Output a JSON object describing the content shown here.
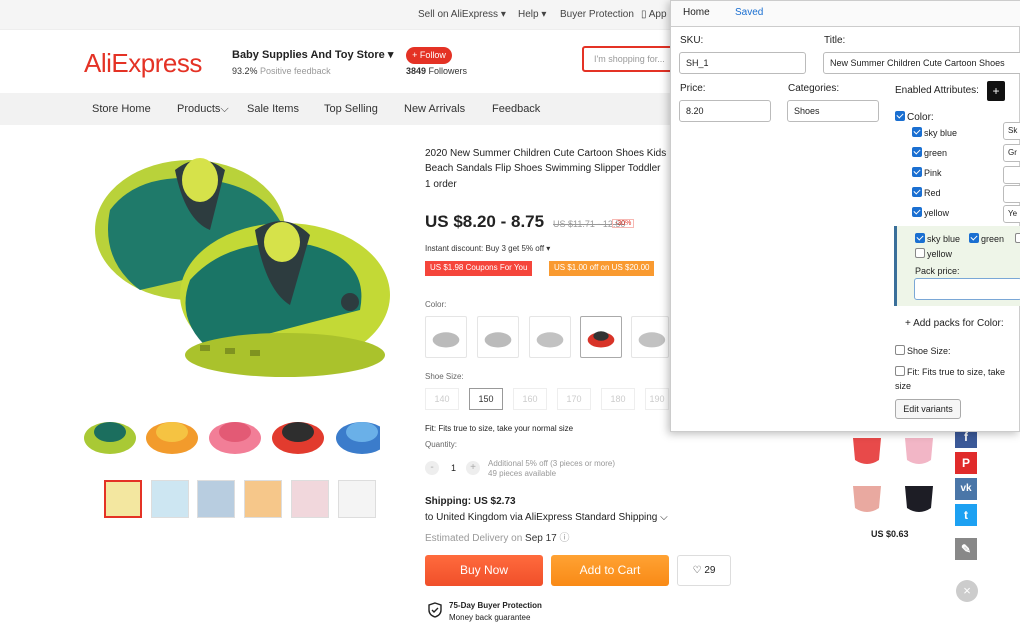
{
  "topbar": {
    "sell": "Sell on AliExpress",
    "help": "Help",
    "protection": "Buyer Protection",
    "app": "App"
  },
  "header": {
    "logo": "AliExpress",
    "store": "Baby Supplies And Toy Store",
    "feedback_pct": "93.2%",
    "feedback_lbl": "Positive feedback",
    "follow": "+ Follow",
    "followers_count": "3849",
    "followers_lbl": "Followers",
    "search_placeholder": "I'm shopping for..."
  },
  "nav": [
    "Store Home",
    "Products",
    "Sale Items",
    "Top Selling",
    "New Arrivals",
    "Feedback"
  ],
  "product": {
    "title": "2020 New Summer Children Cute Cartoon Shoes Kids Beach Sandals Flip Shoes Swimming Slipper Toddler",
    "orders": "1 order",
    "price": "US $8.20 - 8.75",
    "old_price": "US $11.71 - 12.50",
    "discount": "-30%",
    "instant": "Instant discount: Buy 3 get 5% off",
    "coupon1": "US $1.98 Coupons For You",
    "coupon2": "US $1.00 off on US $20.00",
    "color_label": "Color:",
    "size_label": "Shoe Size:",
    "sizes": [
      "140",
      "150",
      "160",
      "170",
      "180",
      "190"
    ],
    "fit": "Fit: Fits true to size, take your normal size",
    "qty_label": "Quantity:",
    "qty": "1",
    "qty_minus": "-",
    "qty_plus": "+",
    "additional": "Additional 5% off (3 pieces or more)",
    "available": "49 pieces available",
    "shipping": "Shipping: US $2.73",
    "ship_to": "to United Kingdom via AliExpress Standard Shipping",
    "delivery_lbl": "Estimated Delivery on",
    "delivery_date": "Sep 17",
    "buy_now": "Buy Now",
    "add_cart": "Add to Cart",
    "wish_count": "29",
    "protect_title": "75-Day Buyer Protection",
    "protect_sub": "Money back guarantee"
  },
  "side": {
    "price": "US $0.63",
    "close": "×"
  },
  "panel": {
    "tabs": [
      "Home",
      "Saved"
    ],
    "sku_lbl": "SKU:",
    "sku_val": "SH_1",
    "title_lbl": "Title:",
    "title_val": "New Summer Children Cute Cartoon Shoes",
    "price_lbl": "Price:",
    "price_val": "8.20",
    "cat_lbl": "Categories:",
    "cat_val": "Shoes",
    "enabled_lbl": "Enabled Attributes:",
    "plus": "+",
    "color_lbl": "Color:",
    "colors": [
      "sky blue",
      "green",
      "Pink",
      "Red",
      "yellow"
    ],
    "side_vals": [
      "Sk",
      "Gr",
      "",
      "",
      "Ye"
    ],
    "pack_colors": [
      "sky blue",
      "green"
    ],
    "pack_yellow": "yellow",
    "pack_price_lbl": "Pack price:",
    "add_packs": "+ Add packs for Color:",
    "shoe_size": "Shoe Size:",
    "fit": "Fit: Fits true to size, take",
    "fit2": "size",
    "edit": "Edit variants"
  }
}
